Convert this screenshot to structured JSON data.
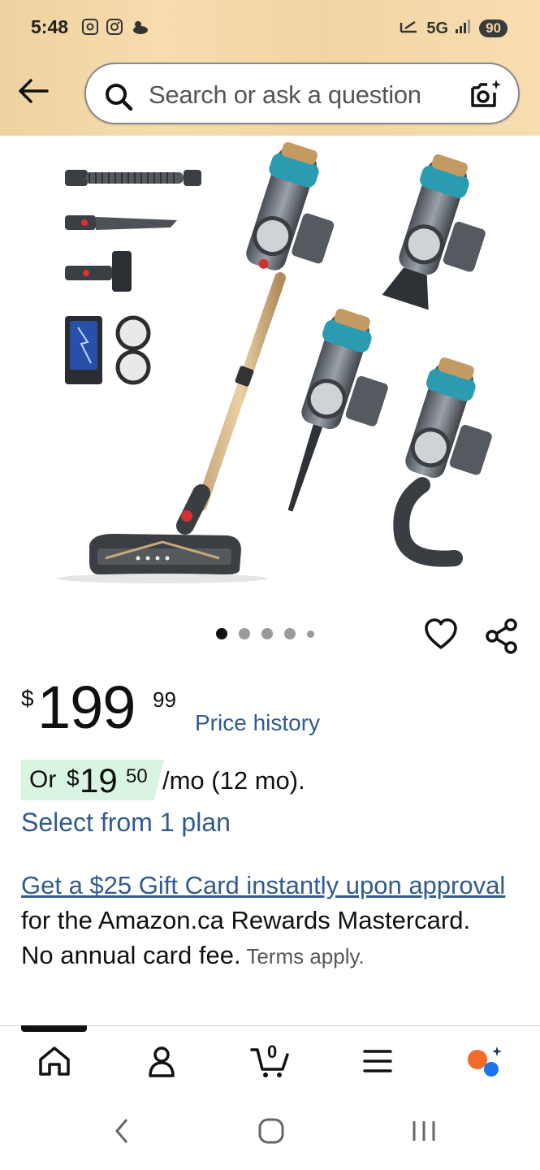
{
  "status_bar": {
    "time": "5:48",
    "network": "5G",
    "battery": "90"
  },
  "search": {
    "placeholder": "Search or ask a question"
  },
  "gallery": {
    "image_count": 5,
    "active_index": 0
  },
  "price": {
    "currency": "$",
    "whole": "199",
    "cents": "99",
    "history_label": "Price history"
  },
  "monthly": {
    "or": "Or",
    "currency": "$",
    "whole": "19",
    "cents": "50",
    "rest": "/mo (12 mo).",
    "plan_link": "Select from 1 plan"
  },
  "promo": {
    "link": "Get a $25 Gift Card instantly upon approval",
    "text": " for the Amazon.ca Rewards Mastercard. No annual card fee.",
    "terms": " Terms apply."
  },
  "tabs": {
    "cart_count": "0",
    "items": [
      "home-icon",
      "account-icon",
      "cart-icon",
      "menu-icon",
      "rufus-icon"
    ]
  },
  "colors": {
    "header": "#f2d5a4",
    "link": "#2f5b8f",
    "badge": "#d9f4e0",
    "accent_orange": "#f26b2a",
    "accent_blue": "#1a73e8"
  }
}
